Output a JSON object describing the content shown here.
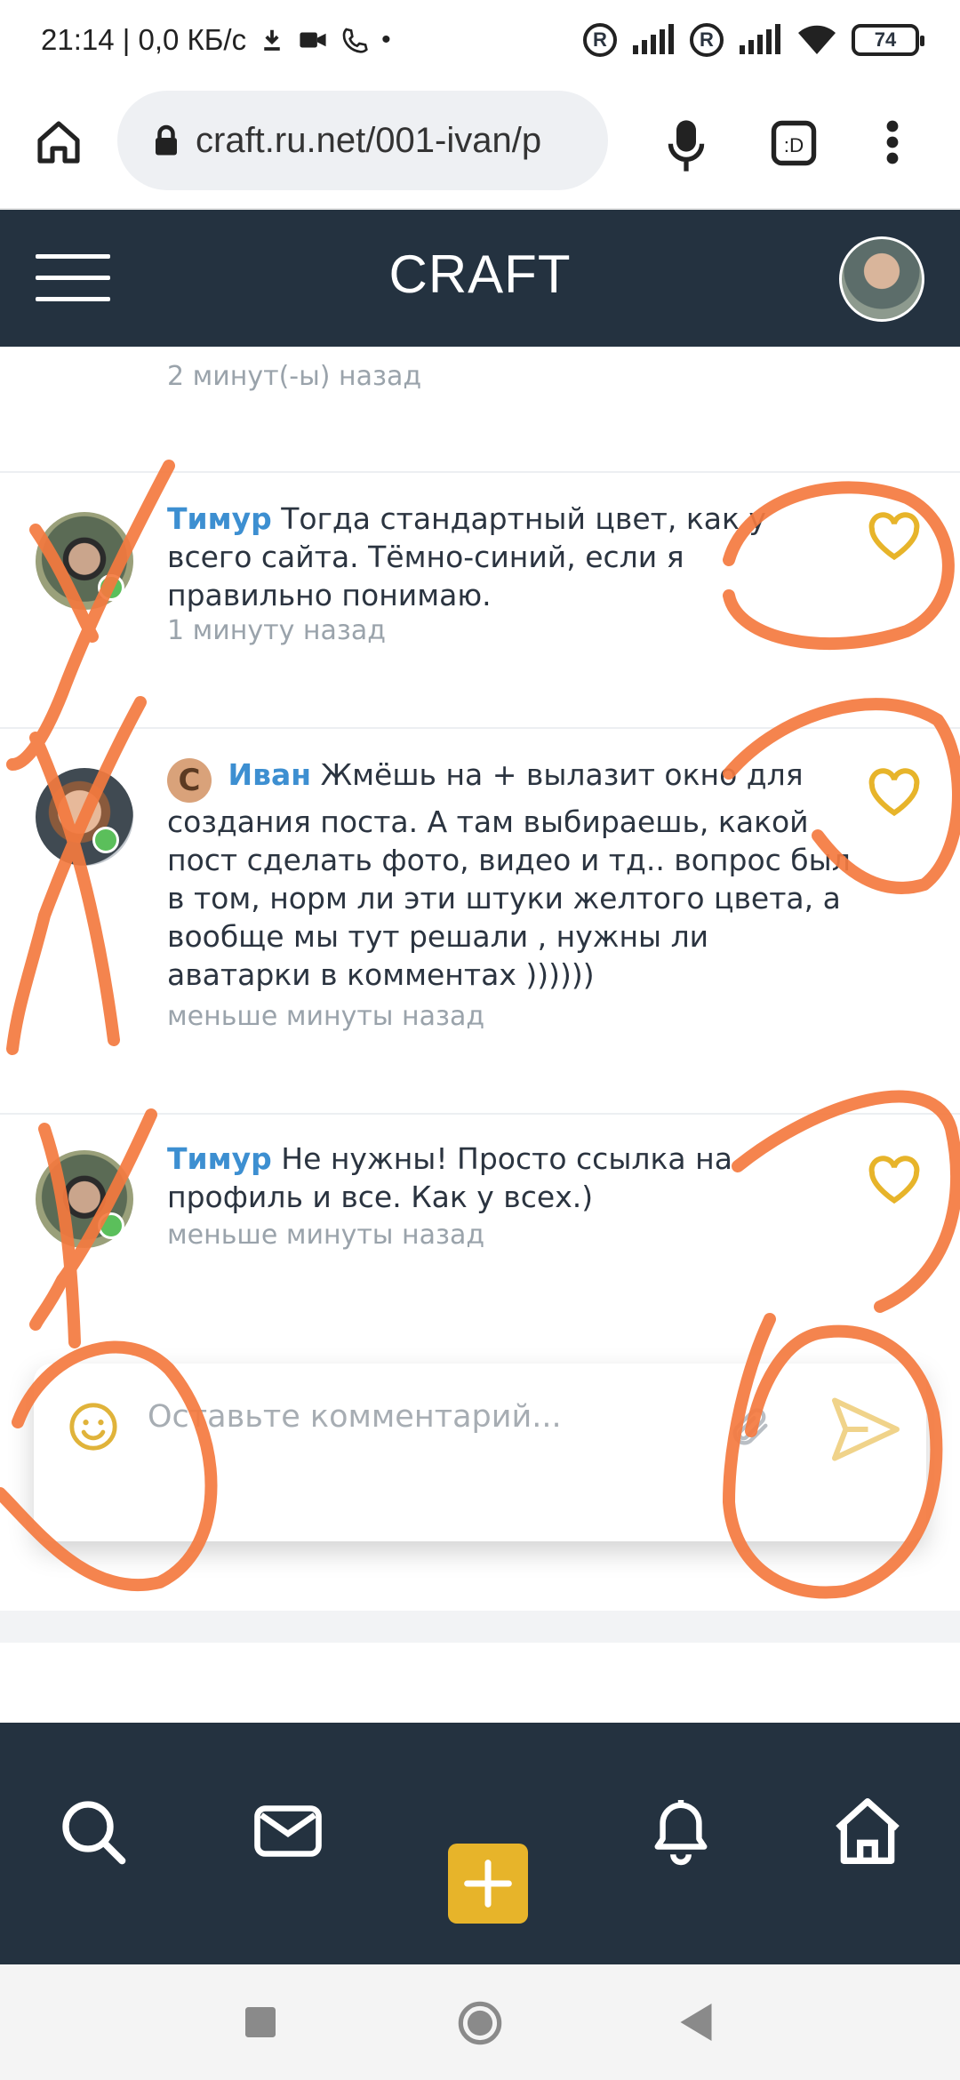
{
  "status_bar": {
    "time_speed": "21:14 | 0,0 КБ/с",
    "battery": "74"
  },
  "browser": {
    "url": "craft.ru.net/001-ivan/p"
  },
  "app": {
    "title": "CRAFT"
  },
  "comments": [
    {
      "author": "",
      "text": "",
      "time": "2 минут(-ы) назад"
    },
    {
      "author": "Тимур",
      "text": "Тогда стандартный цвет, как у всего сайта. Тёмно-синий, если я правильно понимаю.",
      "time": "1 минуту назад"
    },
    {
      "author": "Иван",
      "badge": "C",
      "text": "Жмёшь на + вылазит окно для создания поста. А там выбираешь, какой пост сделать фото, видео и тд.. вопрос был в том, норм ли эти штуки желтого цвета, а вообще мы тут решали , нужны ли аватарки в комментах ))))))",
      "time": "меньше минуты назад"
    },
    {
      "author": "Тимур",
      "text": "Не нужны! Просто ссылка на профиль и все. Как у всех.)",
      "time": "меньше минуты назад"
    }
  ],
  "comment_input": {
    "placeholder": "Оставьте комментарий..."
  },
  "bottom_nav": {
    "items": [
      "search-icon",
      "mail-icon",
      "add-icon",
      "bell-icon",
      "home-icon"
    ]
  },
  "colors": {
    "header_bg": "#243240",
    "author": "#3d8fd1",
    "accent_yellow": "#e7b42a",
    "annotation": "#f47a3f"
  }
}
